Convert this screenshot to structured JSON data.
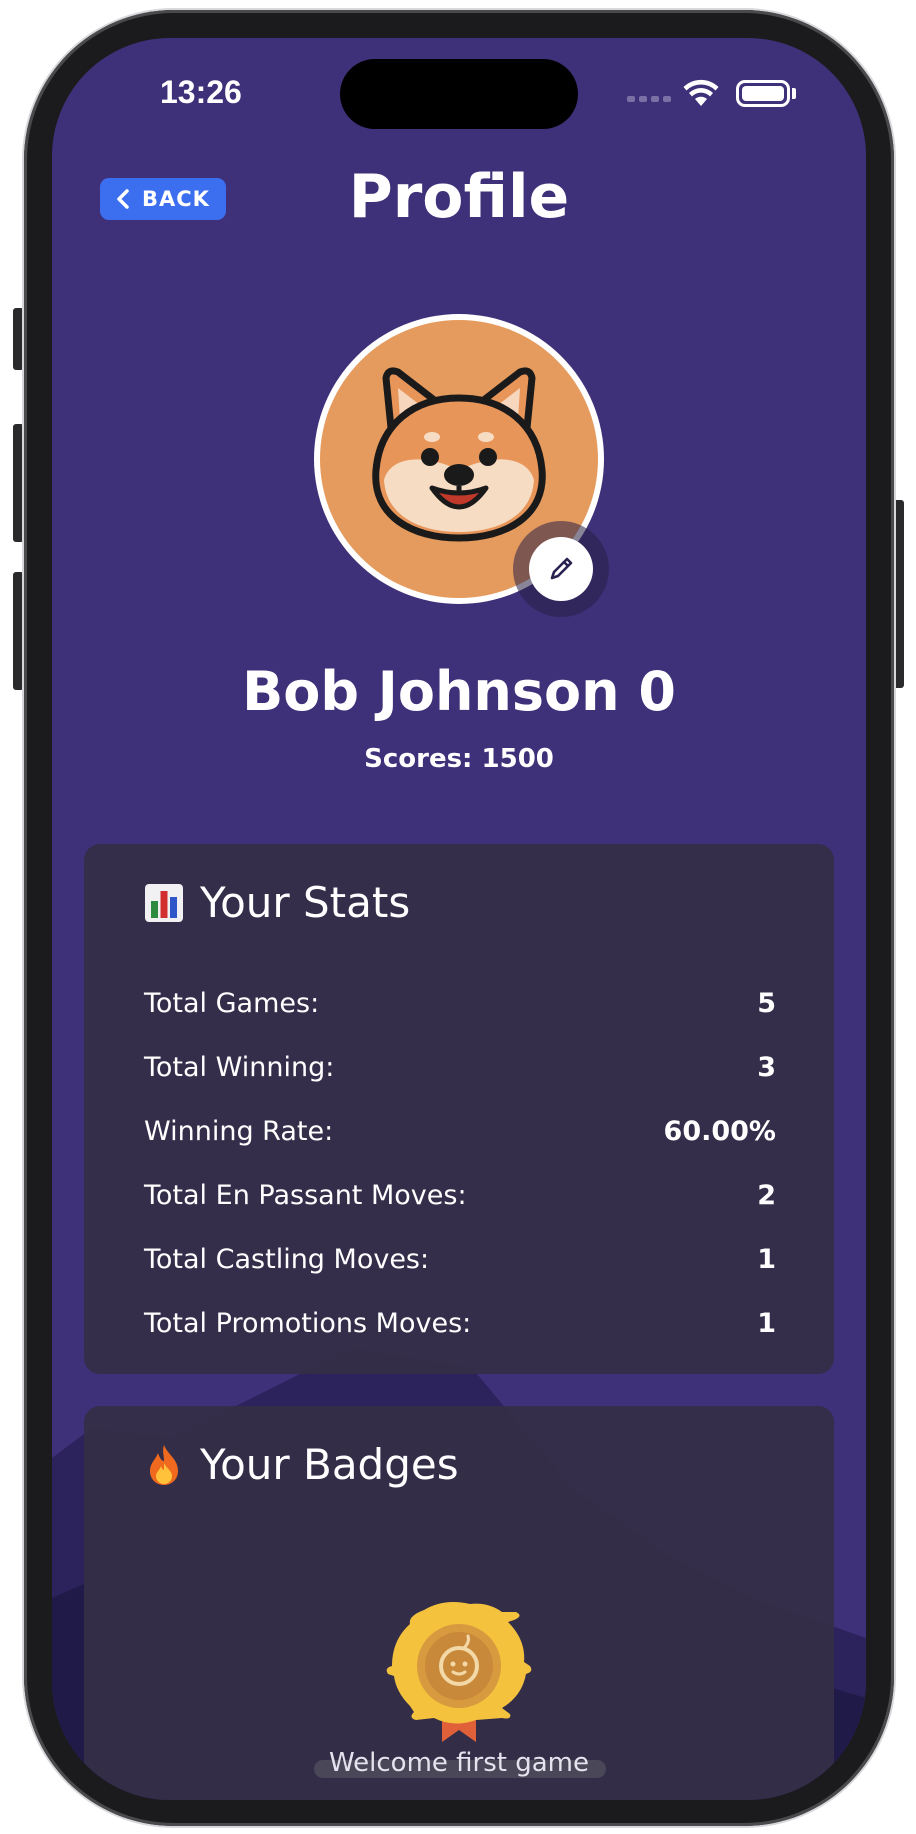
{
  "status_bar": {
    "time": "13:26"
  },
  "header": {
    "back_label": "BACK",
    "title": "Profile"
  },
  "profile": {
    "name": "Bob Johnson 0",
    "score_text": "Scores: 1500"
  },
  "stats": {
    "title": "Your Stats",
    "icon": "bar-chart-emoji",
    "rows": [
      {
        "label": "Total Games:",
        "value": "5"
      },
      {
        "label": "Total Winning:",
        "value": "3"
      },
      {
        "label": "Winning Rate:",
        "value": "60.00%"
      },
      {
        "label": "Total En Passant Moves:",
        "value": "2"
      },
      {
        "label": "Total Castling Moves:",
        "value": "1"
      },
      {
        "label": "Total Promotions Moves:",
        "value": "1"
      }
    ]
  },
  "badges": {
    "title": "Your Badges",
    "icon": "fire-emoji",
    "items": [
      {
        "caption": "Welcome first game"
      }
    ]
  },
  "colors": {
    "background": "#3e3079",
    "card": "#342e48",
    "back_button": "#3c6ef0",
    "avatar_bg": "#e69b5e"
  }
}
